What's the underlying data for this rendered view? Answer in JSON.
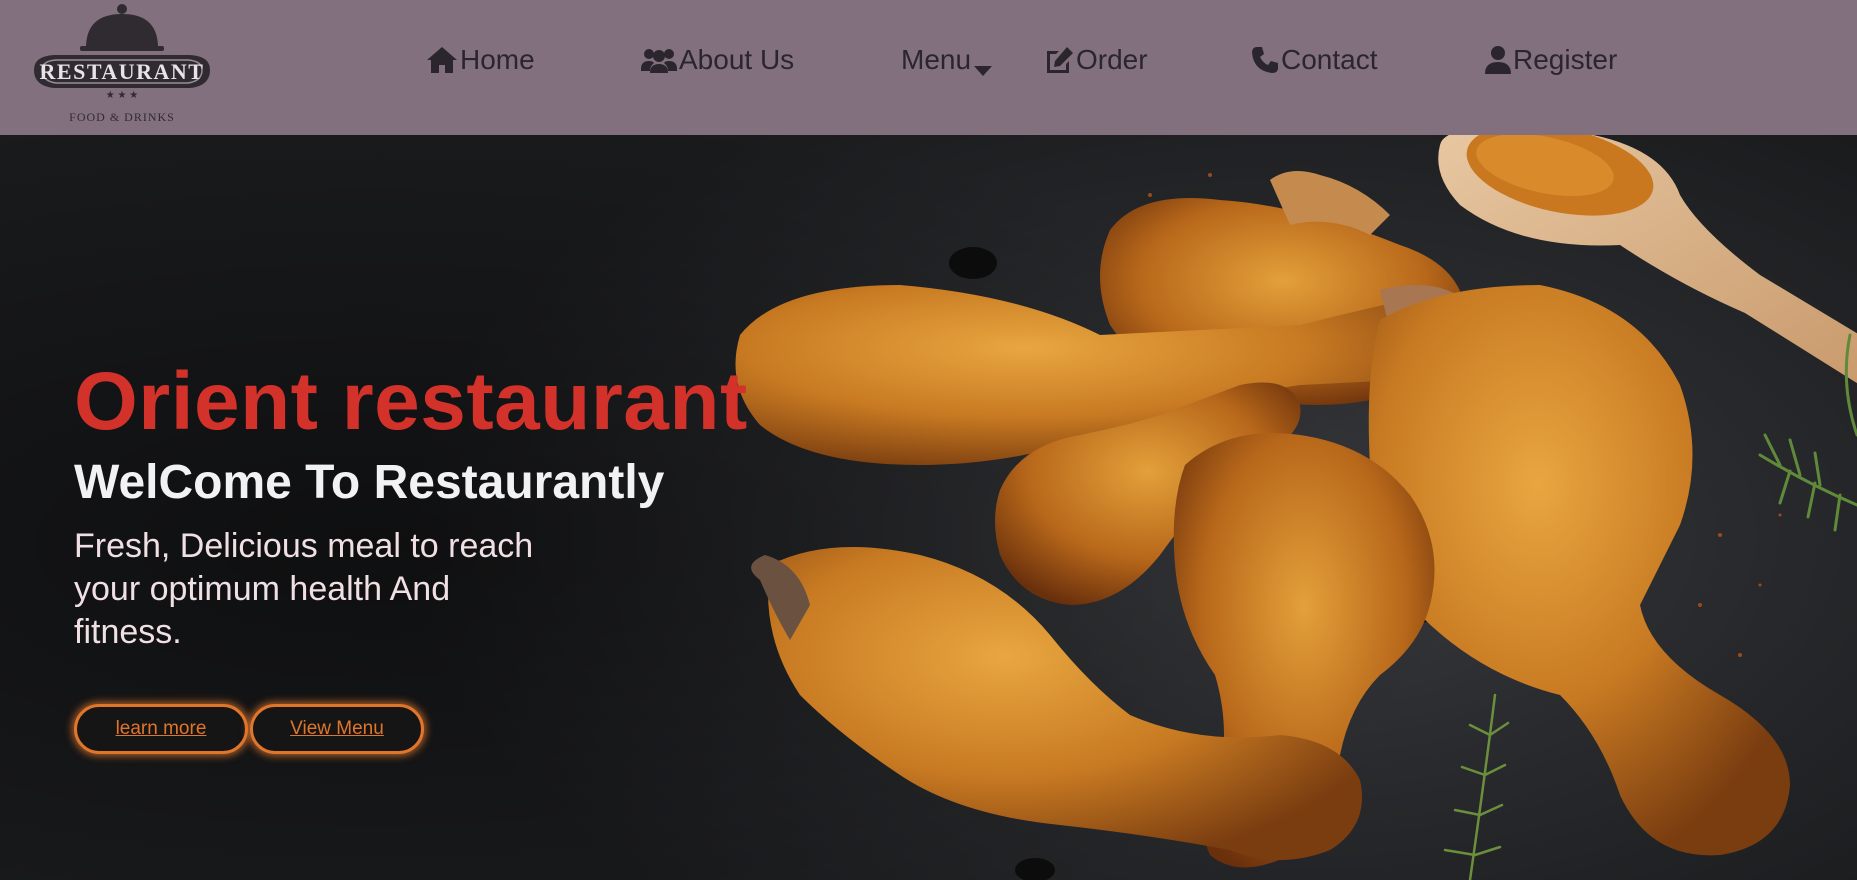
{
  "logo": {
    "brand": "RESTAURANT",
    "tagline": "FOOD & DRINKS"
  },
  "nav": {
    "items": [
      {
        "label": "Home",
        "icon": "home-icon"
      },
      {
        "label": "About Us",
        "icon": "users-icon"
      },
      {
        "label": "Menu",
        "icon": "caret-down-icon"
      },
      {
        "label": "Order",
        "icon": "edit-icon"
      },
      {
        "label": "Contact",
        "icon": "phone-icon"
      },
      {
        "label": "Register",
        "icon": "user-icon"
      }
    ]
  },
  "hero": {
    "title": "Orient restaurant",
    "subtitle": "WelCome To Restaurantly",
    "description": "Fresh, Delicious meal to reach your optimum health And fitness.",
    "buttons": {
      "learn_more": "learn more",
      "view_menu": "View Menu"
    }
  },
  "colors": {
    "navbar_bg": "#82707e",
    "title_red": "#d3322a",
    "button_orange": "#e0752c"
  }
}
